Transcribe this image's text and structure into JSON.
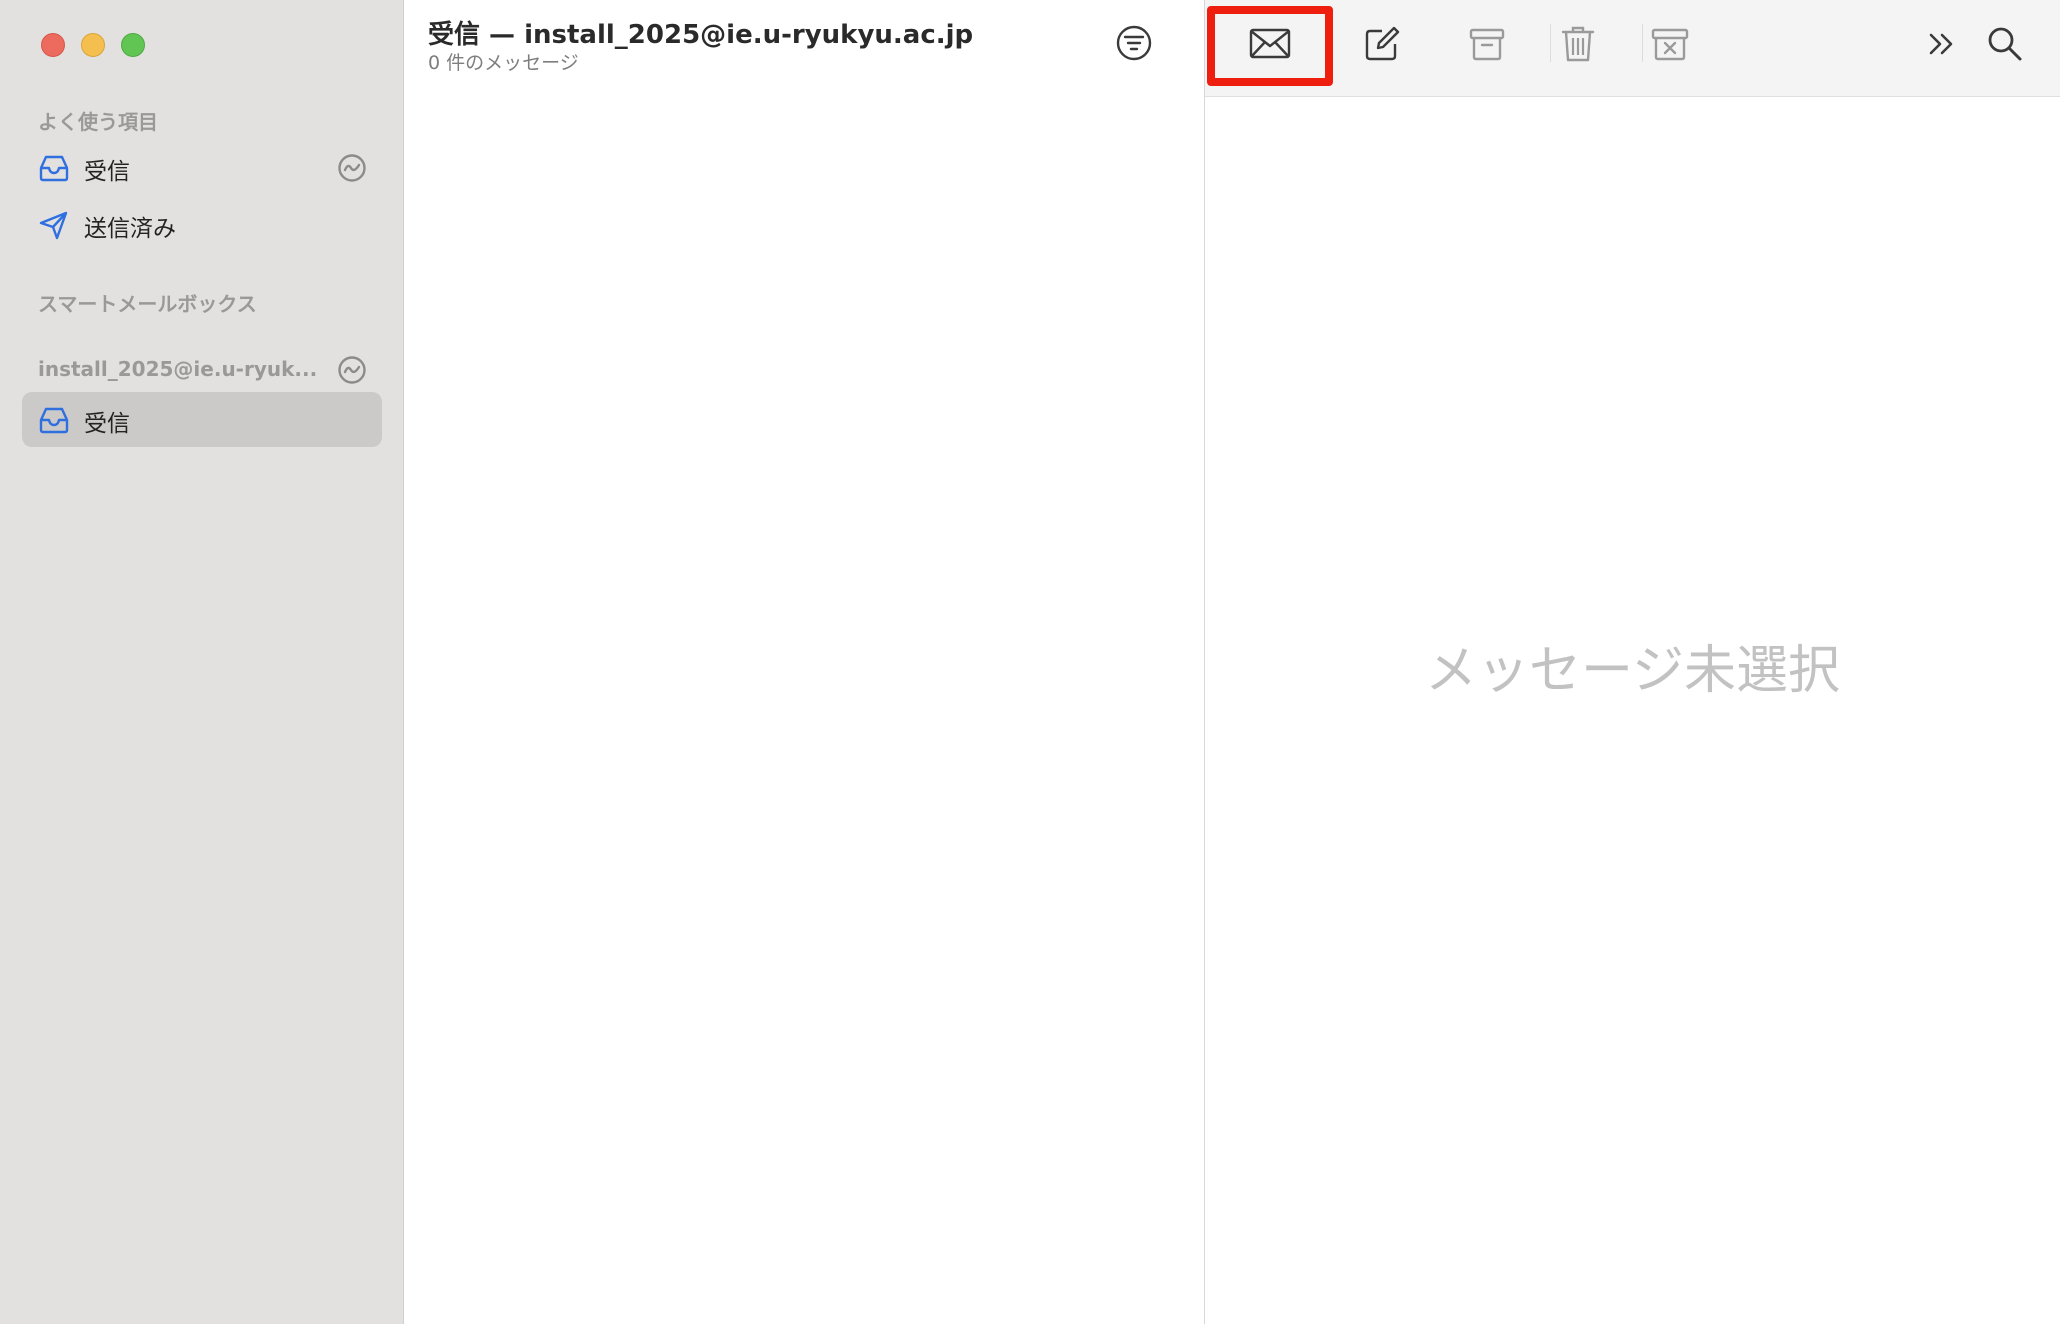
{
  "window": {
    "traffic_lights": [
      "close",
      "minimize",
      "zoom"
    ]
  },
  "sidebar": {
    "favorites_header": "よく使う項目",
    "favorites": [
      {
        "label": "受信",
        "icon": "inbox-icon",
        "has_activity": true
      },
      {
        "label": "送信済み",
        "icon": "paperplane-icon",
        "has_activity": false
      }
    ],
    "smart_mailboxes_header": "スマートメールボックス",
    "account_header": "install_2025@ie.u-ryuk...",
    "account_items": [
      {
        "label": "受信",
        "icon": "inbox-icon",
        "selected": true
      }
    ]
  },
  "message_list": {
    "title": "受信 — install_2025@ie.u-ryukyu.ac.jp",
    "subtitle": "0 件のメッセージ",
    "filter_icon": "filter-icon"
  },
  "viewer": {
    "toolbar": {
      "buttons": [
        "envelope-icon",
        "compose-icon",
        "archive-icon",
        "trash-icon",
        "junk-icon",
        "more-icon",
        "search-icon"
      ],
      "highlighted": "envelope-icon"
    },
    "empty_text": "メッセージ未選択"
  },
  "colors": {
    "accent": "#2f6fe0",
    "highlight": "#ee1f0e",
    "sidebar_bg": "#e2e1df",
    "selected_bg": "#cbcac8"
  }
}
